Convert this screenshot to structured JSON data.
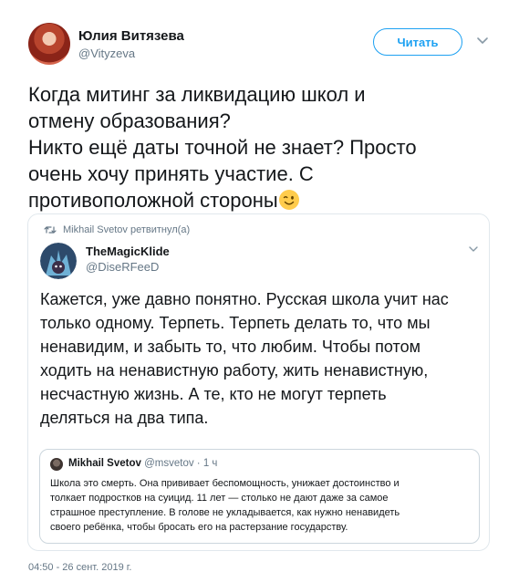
{
  "author": {
    "display_name": "Юлия Витязева",
    "handle": "@Vityzeva"
  },
  "follow_button": {
    "label": "Читать"
  },
  "tweet": {
    "text": "Когда митинг за ликвидацию школ и отмену образования? Никто ещё даты точной не знает? Просто очень хочу принять участие. С противоположной стороны",
    "lines": [
      "Когда митинг за ликвидацию школ и",
      "отмену образования?",
      "Никто ещё даты точной не знает? Просто",
      "очень хочу принять участие. С",
      "противоположной стороны"
    ],
    "emoji": "winking-face-emoji"
  },
  "quoted": {
    "retweet_context": "Mikhail Svetov ретвитнул(а)",
    "author": {
      "display_name": "TheMagicKlide",
      "handle": "@DiseRFeeD"
    },
    "lines": [
      "Кажется, уже давно понятно. Русская школа учит нас",
      "только одному. Терпеть. Терпеть делать то, что мы",
      "ненавидим, и забыть то, что любим. Чтобы потом",
      "ходить на ненавистную работу, жить ненавистную,",
      "несчастную жизнь. А те, кто не могут терпеть",
      "деляться на два типа."
    ],
    "inner": {
      "author_name": "Mikhail Svetov",
      "handle": "@msvetov",
      "separator": "·",
      "time": "1 ч",
      "lines": [
        "Школа это смерть. Она прививает беспомощность, унижает достоинство и",
        "толкает подростков на суицид. 11 лет — столько не дают даже за самое",
        "страшное преступление. В голове не укладывается, как нужно ненавидеть",
        "своего ребёнка, чтобы бросать его на растерзание государству."
      ]
    }
  },
  "timestamp": "04:50 - 26 сент. 2019 г.",
  "colors": {
    "accent": "#1da1f2",
    "muted": "#657786",
    "border": "#e1e8ed"
  }
}
